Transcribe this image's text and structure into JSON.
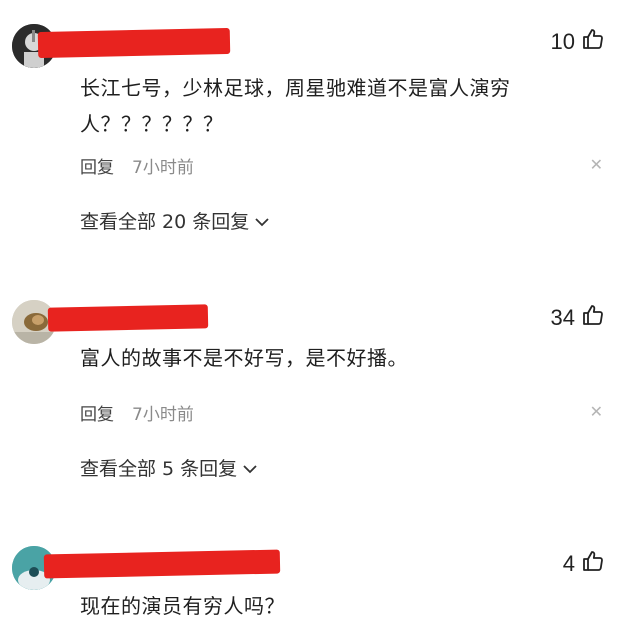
{
  "comments": [
    {
      "likes": "10",
      "text": "长江七号，少林足球，周星驰难道不是富人演穷人？？？？？？",
      "reply_label": "回复",
      "time": "7小时前",
      "view_all": "查看全部 20 条回复"
    },
    {
      "likes": "34",
      "text": "富人的故事不是不好写，是不好播。",
      "reply_label": "回复",
      "time": "7小时前",
      "view_all": "查看全部 5 条回复"
    },
    {
      "likes": "4",
      "text": "现在的演员有穷人吗？"
    }
  ],
  "icons": {
    "like": "thumbs-up-icon",
    "close": "close-icon",
    "expand": "chevron-down-icon"
  },
  "colors": {
    "redaction": "#e8231f",
    "avatar3_bg": "#4aa3a5"
  }
}
